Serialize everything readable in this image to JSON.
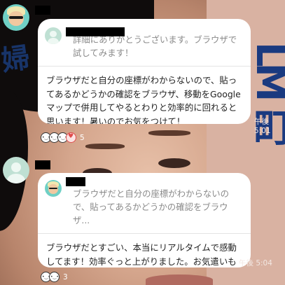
{
  "messages": [
    {
      "quote_text": "詳細にありがとうございます。ブラウザで試してみます！",
      "body_text": "ブラウザだと自分の座標がわからないので、貼ってあるかどうかの確認をブラウザ、移動をGoogleマップで併用してやるとわりと効率的に回れると思います！暑いのでお気をつけて！",
      "time": "午後 5:01",
      "reaction_count": "5"
    },
    {
      "quote_text": "ブラウザだと自分の座標がわからないので、貼ってあるかどうかの確認をブラウザ...",
      "body_text": "ブラウザだとすごい、本当にリアルタイムで感動してます！効率ぐっと上がりました。お気遣いも含めまして、ありがとうございます！！",
      "time": "午後 5:04",
      "reaction_count": "3"
    }
  ],
  "background": {
    "left_char": "婦",
    "right_text": "LM 町"
  },
  "colors": {
    "bubble": "#ffffff",
    "quote_text": "#8a8a8a",
    "body_text": "#222222",
    "avatar_teal": "#6fd0c5",
    "avatar_default": "#bfe0d3"
  },
  "icons": {
    "cartoon_avatar": "user-avatar-cartoon",
    "default_avatar": "default-user-avatar",
    "reactions": [
      "smile-reaction-icon",
      "heart-reaction-icon"
    ]
  }
}
